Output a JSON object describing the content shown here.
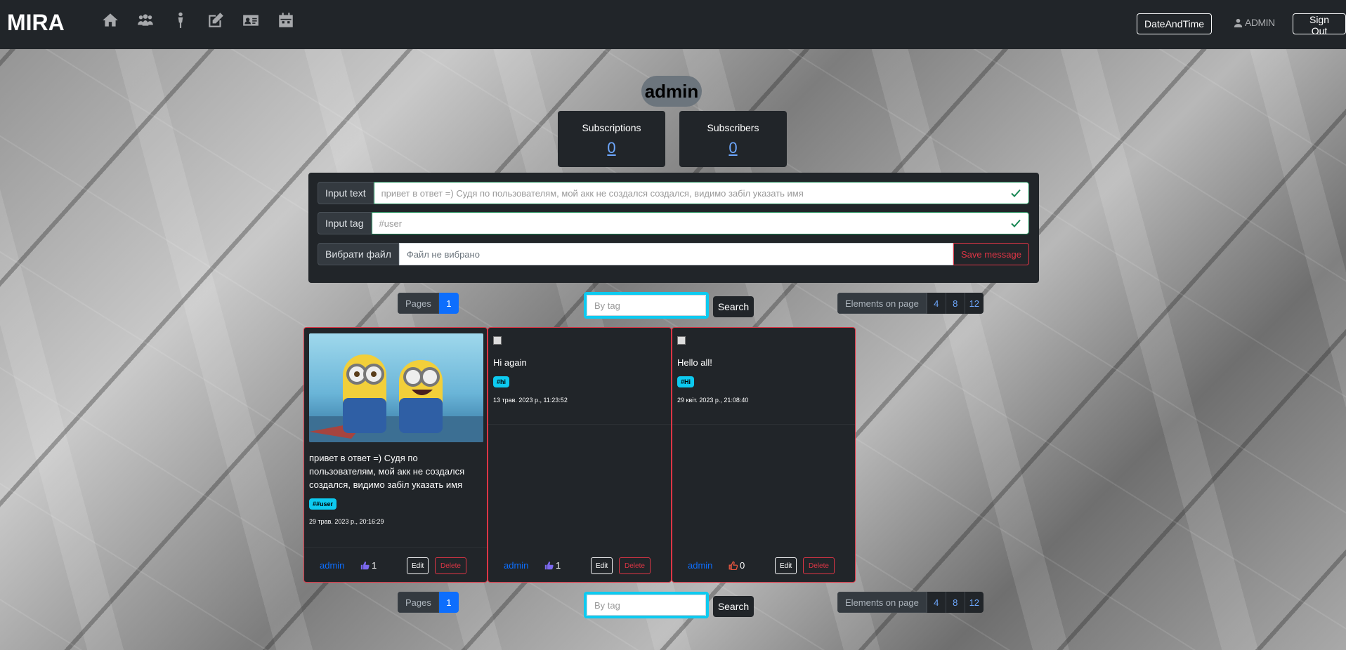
{
  "navbar": {
    "brand": "MIRA",
    "icons": [
      "home-icon",
      "people-icon",
      "person-icon",
      "edit-icon",
      "id-card-icon",
      "calendar-icon"
    ],
    "datetime_label": "DateAndTime",
    "user_label": "ADMIN",
    "signout_label": "Sign Out"
  },
  "profile": {
    "username": "admin",
    "subscriptions_label": "Subscriptions",
    "subscriptions_count": "0",
    "subscribers_label": "Subscribers",
    "subscribers_count": "0"
  },
  "form": {
    "text_label": "Input text",
    "text_value": "привет в ответ =) Судя по пользователям, мой акк не создался создался, видимо забіл указать имя",
    "tag_label": "Input tag",
    "tag_value": "#user",
    "file_label": "Вибрати файл",
    "file_value": "Файл не вибрано",
    "save_label": "Save message"
  },
  "pagination": {
    "pages_label": "Pages",
    "current_page": "1",
    "elements_label": "Elements on page",
    "sizes": [
      "4",
      "8",
      "12"
    ],
    "search_placeholder": "By tag",
    "search_label": "Search"
  },
  "posts": [
    {
      "text": "привет в ответ =) Судя по пользователям, мой акк не создался создался, видимо забіл указать имя",
      "tag": "##user",
      "date": "29 трав. 2023 р., 20:16:29",
      "author": "admin",
      "likes": "1",
      "liked": true,
      "edit_label": "Edit",
      "delete_label": "Delete"
    },
    {
      "text": "Hi again",
      "tag": "#hi",
      "date": "13 трав. 2023 р., 11:23:52",
      "author": "admin",
      "likes": "1",
      "liked": true,
      "edit_label": "Edit",
      "delete_label": "Delete"
    },
    {
      "text": "Hello all!",
      "tag": "#Hi",
      "date": "29 квіт. 2023 р., 21:08:40",
      "author": "admin",
      "likes": "0",
      "liked": false,
      "edit_label": "Edit",
      "delete_label": "Delete"
    }
  ],
  "colors": {
    "navbar": "#212529",
    "accent": "#0d6efd",
    "danger": "#dc3545",
    "info": "#0dcaf0",
    "like_active": "#7b68ee",
    "like_inactive": "#e8563f"
  }
}
